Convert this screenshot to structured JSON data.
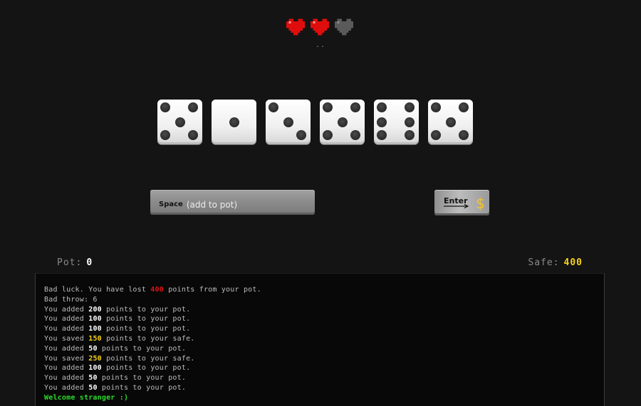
{
  "hearts": {
    "total": 3,
    "filled": 2,
    "colors": {
      "full": "#e00d0d",
      "empty": "#5a5a5a"
    }
  },
  "indicator": "..",
  "dice": [
    5,
    1,
    3,
    5,
    6,
    5
  ],
  "controls": {
    "space": {
      "key": "Space",
      "hint": "(add to pot)"
    },
    "enter": {
      "key": "Enter",
      "icon": "dollar-icon",
      "symbol": "$"
    }
  },
  "score": {
    "pot_label": "Pot:",
    "pot_value": "0",
    "safe_label": "Safe:",
    "safe_value": "400"
  },
  "log": [
    {
      "before": "Bad luck. You have lost ",
      "num": "400",
      "color": "red",
      "after": " points from your pot."
    },
    {
      "text": "Bad throw: 6"
    },
    {
      "before": "You added ",
      "num": "200",
      "color": "white",
      "after": " points to your pot."
    },
    {
      "before": "You added ",
      "num": "100",
      "color": "white",
      "after": " points to your pot."
    },
    {
      "before": "You added ",
      "num": "100",
      "color": "white",
      "after": " points to your pot."
    },
    {
      "before": "You saved ",
      "num": "150",
      "color": "yellow",
      "after": " points to your safe."
    },
    {
      "before": "You added ",
      "num": "50",
      "color": "white",
      "after": " points to your pot."
    },
    {
      "before": "You saved ",
      "num": "250",
      "color": "yellow",
      "after": " points to your safe."
    },
    {
      "before": "You added ",
      "num": "100",
      "color": "white",
      "after": " points to your pot."
    },
    {
      "before": "You added ",
      "num": "50",
      "color": "white",
      "after": " points to your pot."
    },
    {
      "before": "You added ",
      "num": "50",
      "color": "white",
      "after": " points to your pot."
    },
    {
      "text": "Welcome stranger :)",
      "color": "green"
    }
  ]
}
